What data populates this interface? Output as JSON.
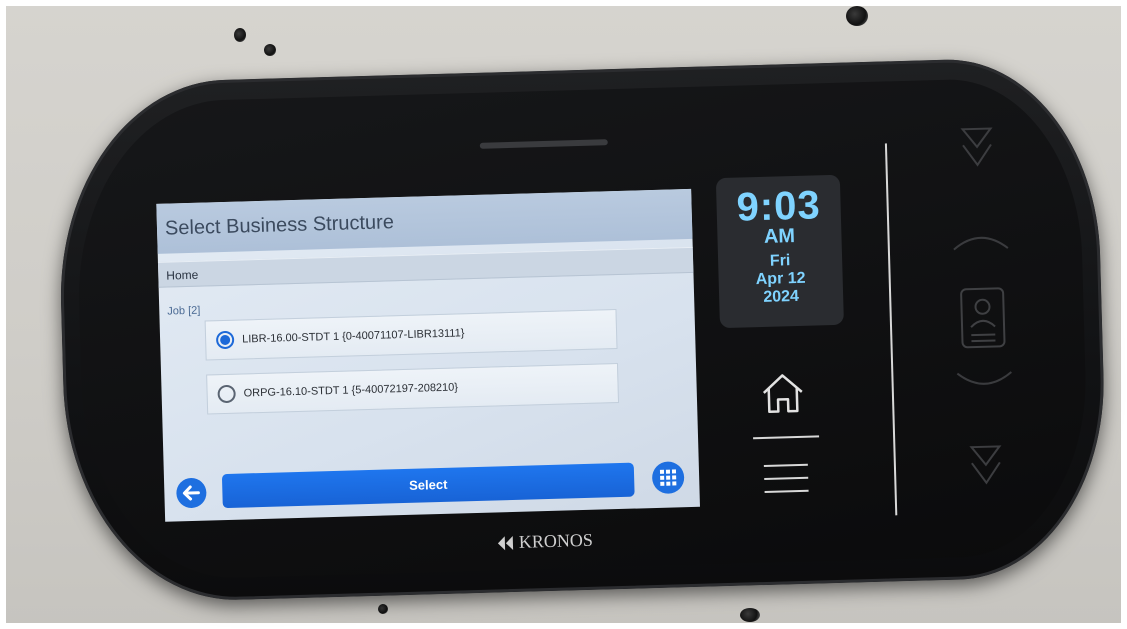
{
  "screen": {
    "title": "Select Business Structure",
    "breadcrumb": "Home",
    "section_label": "Job [2]",
    "options": [
      {
        "label": "LIBR-16.00-STDT 1 {0-40071107-LIBR13111}",
        "selected": true
      },
      {
        "label": "ORPG-16.10-STDT 1 {5-40072197-208210}",
        "selected": false
      }
    ],
    "select_button": "Select",
    "back_icon": "arrow-left-icon",
    "apps_icon": "grid-icon"
  },
  "clock": {
    "time": "9:03",
    "ampm": "AM",
    "weekday": "Fri",
    "date": "Apr 12",
    "year": "2024"
  },
  "device": {
    "brand": "KRONOS",
    "home_icon": "home-icon",
    "menu_icon": "menu-icon",
    "badge_icon": "badge-reader-icon"
  },
  "colors": {
    "accent": "#1e6fe0",
    "clock_text": "#7fd3ff",
    "device_body": "#111214"
  }
}
